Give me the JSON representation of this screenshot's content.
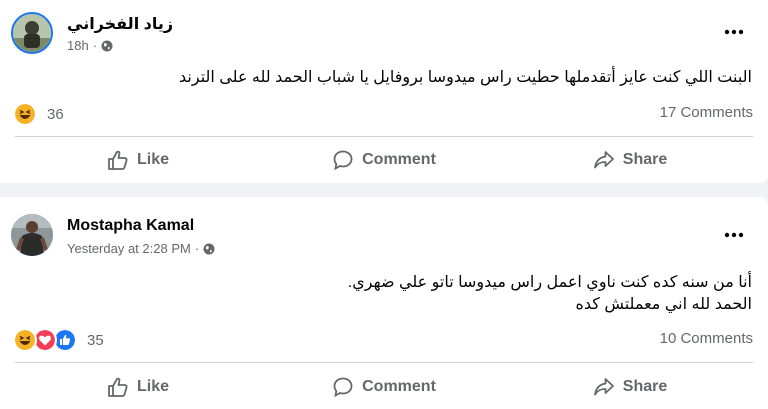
{
  "posts": [
    {
      "author": "زياد الفخراني",
      "time": "18h",
      "separator": "·",
      "text_lines": [
        "البنت اللي كنت عايز أتقدملها حطيت راس ميدوسا بروفايل يا شباب الحمد لله على الترند"
      ],
      "reactions": {
        "icons": [
          "haha-icon"
        ],
        "count": "36"
      },
      "comments": "17 Comments"
    },
    {
      "author": "Mostapha Kamal",
      "time": "Yesterday at 2:28 PM",
      "separator": "·",
      "text_lines": [
        "أنا من سنه كده كنت ناوي اعمل راس ميدوسا تاتو علي ضهري.",
        "الحمد لله اني معملتش كده"
      ],
      "reactions": {
        "icons": [
          "haha-icon",
          "love-icon",
          "like-icon"
        ],
        "count": "35"
      },
      "comments": "10 Comments"
    }
  ],
  "actions": {
    "like": "Like",
    "comment": "Comment",
    "share": "Share"
  },
  "colors": {
    "brand": "#1877f2",
    "secondary_text": "#65676b",
    "love": "#f33e58",
    "haha": "#f7b125"
  }
}
